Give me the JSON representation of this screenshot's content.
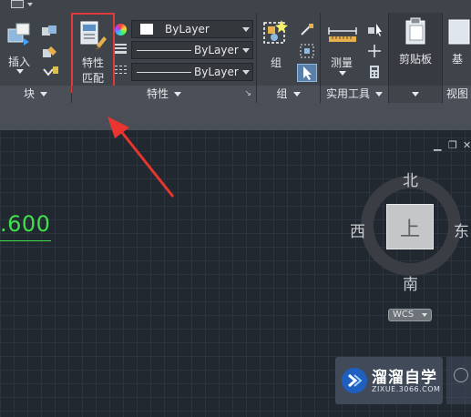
{
  "ribbon": {
    "block_panel": {
      "insert_label": "插入",
      "panel_label": "块"
    },
    "match_properties": {
      "line1": "特性",
      "line2": "匹配"
    },
    "properties_panel": {
      "color_value": "ByLayer",
      "lineweight_value": "ByLayer",
      "linetype_value": "ByLayer",
      "panel_label": "特性"
    },
    "group_panel": {
      "group_label": "组",
      "panel_label": "组"
    },
    "utilities_panel": {
      "measure_label": "测量",
      "panel_label": "实用工具"
    },
    "clipboard_panel": {
      "clipboard_label": "剪贴板"
    },
    "view_panel": {
      "panel_label": "视图",
      "base_label": "基"
    }
  },
  "canvas": {
    "dimension_text": ".600",
    "viewcube": {
      "north": "北",
      "south": "南",
      "west": "西",
      "east": "东",
      "top_label": "上"
    },
    "wcs_label": "WCS",
    "window_controls": {
      "minimize": "▁",
      "restore": "❐",
      "close": "✕"
    }
  },
  "watermark": {
    "brand": "溜溜自学",
    "url": "ZIXUE.3066.COM"
  },
  "colors": {
    "highlight_box": "#e03a3a",
    "dimension_green": "#3ee14a",
    "ribbon_bg": "#3f434a",
    "canvas_bg": "#212830"
  }
}
